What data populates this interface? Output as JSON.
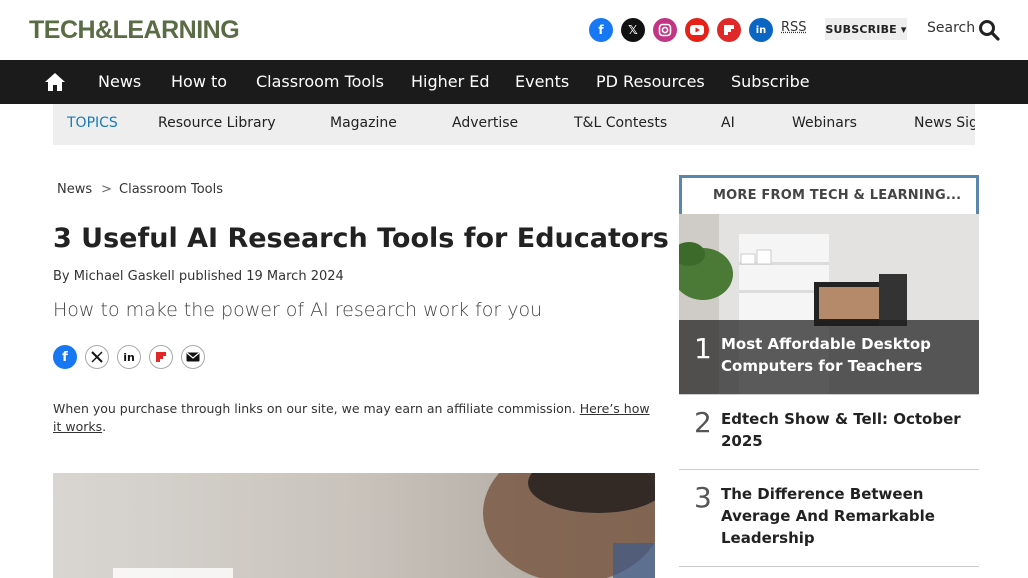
{
  "header": {
    "logo_text": "TECH&LEARNING",
    "social": [
      "facebook-icon",
      "x-icon",
      "instagram-icon",
      "youtube-icon",
      "flipboard-icon",
      "linkedin-icon"
    ],
    "rss": "RSS",
    "subscribe": "SUBSCRIBE ▾",
    "search": "Search"
  },
  "nav": {
    "items": [
      "News",
      "How to",
      "Classroom Tools",
      "Higher Ed",
      "Events",
      "PD Resources",
      "Subscribe"
    ]
  },
  "topics": {
    "label": "TOPICS",
    "items": [
      "Resource Library",
      "Magazine",
      "Advertise",
      "T&L Contests",
      "AI",
      "Webinars",
      "News Sig"
    ]
  },
  "breadcrumb": {
    "items": [
      "News",
      "Classroom Tools"
    ],
    "separator": ">"
  },
  "article": {
    "title": "3 Useful AI Research Tools for Educators",
    "byline": "By Michael Gaskell published 19 March 2024",
    "subtitle": "How to make the power of AI research work for you",
    "share": [
      "facebook-icon",
      "x-icon",
      "linkedin-icon",
      "flipboard-icon",
      "email-icon"
    ],
    "affiliate_text": "When you purchase through links on our site, we may earn an affiliate commission. ",
    "affiliate_link": "Here’s how it works",
    "affiliate_end": "."
  },
  "sidebar": {
    "title": "MORE FROM TECH & LEARNING...",
    "items": [
      {
        "rank": "1",
        "title": "Most Affordable Desktop Computers for Teachers"
      },
      {
        "rank": "2",
        "title": "Edtech Show & Tell: October 2025"
      },
      {
        "rank": "3",
        "title": "The Difference Between Average And Remarkable Leadership"
      }
    ]
  },
  "colors": {
    "nav_bg": "#1b1b1b",
    "topics_bg": "#eeeeee",
    "topics_label": "#1a7ab8",
    "sidebar_border": "#5a86ad",
    "facebook": "#1877f2",
    "youtube": "#e62117",
    "instagram": "#c13584",
    "flipboard": "#e12828",
    "linkedin": "#0a66c2"
  }
}
